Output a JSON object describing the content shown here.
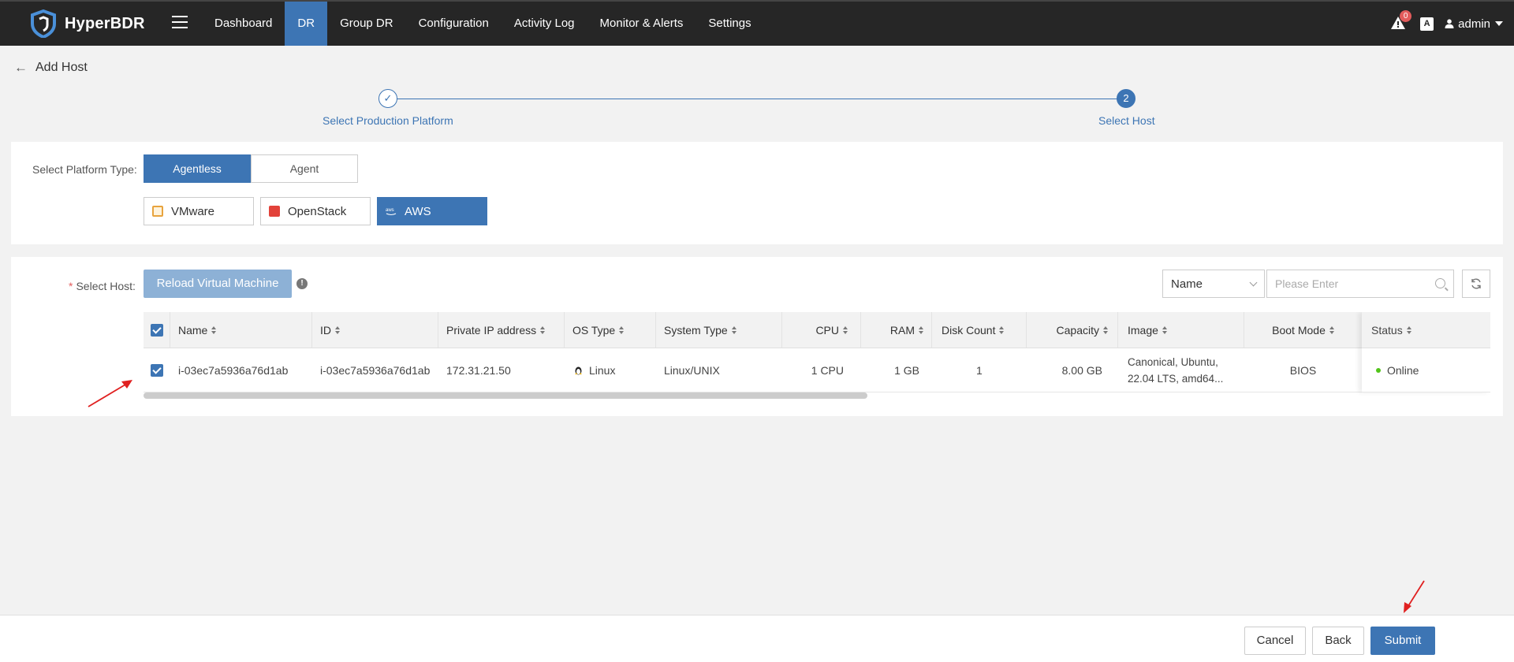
{
  "app": {
    "name": "HyperBDR"
  },
  "nav": {
    "items": [
      {
        "label": "Dashboard"
      },
      {
        "label": "DR"
      },
      {
        "label": "Group DR"
      },
      {
        "label": "Configuration"
      },
      {
        "label": "Activity Log"
      },
      {
        "label": "Monitor & Alerts"
      },
      {
        "label": "Settings"
      }
    ],
    "active": "DR"
  },
  "topbar": {
    "alert_count": "0",
    "lang_glyph": "A",
    "user": "admin"
  },
  "page": {
    "title": "Add Host"
  },
  "steps": [
    {
      "label": "Select Production Platform",
      "state": "done"
    },
    {
      "label": "Select Host",
      "number": "2",
      "state": "active"
    }
  ],
  "platform": {
    "label": "Select Platform Type:",
    "types": [
      "Agentless",
      "Agent"
    ],
    "selected_type": "Agentless",
    "platforms": [
      {
        "label": "VMware",
        "icon": "vmware-icon",
        "color": "#e8a33d"
      },
      {
        "label": "OpenStack",
        "icon": "openstack-icon",
        "color": "#e2423a"
      },
      {
        "label": "AWS",
        "icon": "aws-icon",
        "color": "#ffffff"
      }
    ],
    "selected_platform": "AWS"
  },
  "host": {
    "label": "Select Host:",
    "required_mark": "*",
    "reload_label": "Reload Virtual Machine",
    "info_glyph": "!",
    "filter_field": "Name",
    "search_placeholder": "Please Enter"
  },
  "table": {
    "columns": [
      "Name",
      "ID",
      "Private IP address",
      "OS Type",
      "System Type",
      "CPU",
      "RAM",
      "Disk Count",
      "Capacity",
      "Image",
      "Boot Mode",
      "Status"
    ],
    "rows": [
      {
        "selected": true,
        "name": "i-03ec7a5936a76d1ab",
        "id": "i-03ec7a5936a76d1ab",
        "private_ip": "172.31.21.50",
        "os_type": "Linux",
        "system_type": "Linux/UNIX",
        "cpu": "1 CPU",
        "ram": "1 GB",
        "disk_count": "1",
        "capacity": "8.00 GB",
        "image_line1": "Canonical, Ubuntu,",
        "image_line2": "22.04 LTS, amd64...",
        "boot_mode": "BIOS",
        "status": "Online"
      }
    ]
  },
  "footer": {
    "cancel": "Cancel",
    "back": "Back",
    "submit": "Submit"
  },
  "colors": {
    "primary": "#3d75b4",
    "topbar": "#262626",
    "online": "#52c41a",
    "annotation": "#e02020"
  }
}
